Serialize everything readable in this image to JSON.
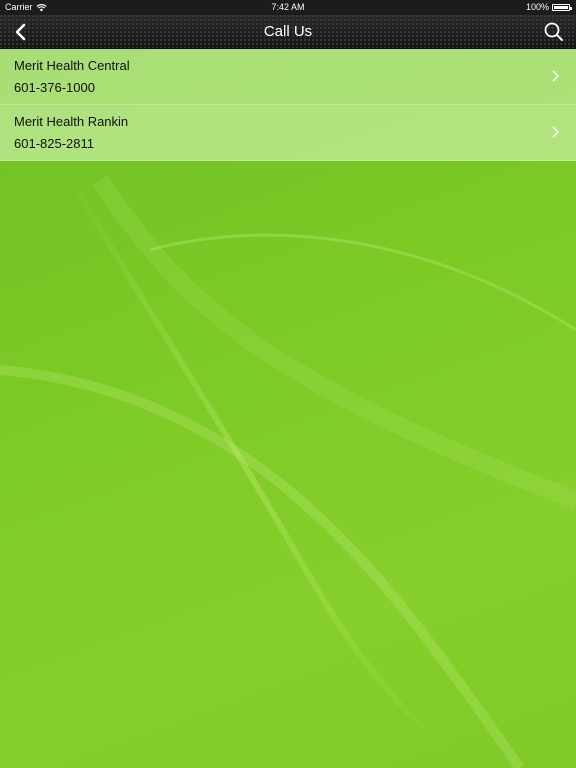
{
  "status_bar": {
    "carrier": "Carrier",
    "time": "7:42 AM",
    "battery": "100%",
    "icons": [
      "wifi-icon",
      "battery-icon"
    ]
  },
  "nav": {
    "title": "Call Us",
    "icons": [
      "back-chevron-icon",
      "search-icon"
    ]
  },
  "locations": [
    {
      "name": "Merit Health Central",
      "phone": "601-376-1000"
    },
    {
      "name": "Merit Health Rankin",
      "phone": "601-825-2811"
    }
  ],
  "colors": {
    "background_green": "#7cc926",
    "list_tint": "#cdf0aa",
    "nav_bar": "#1e1e1e"
  }
}
